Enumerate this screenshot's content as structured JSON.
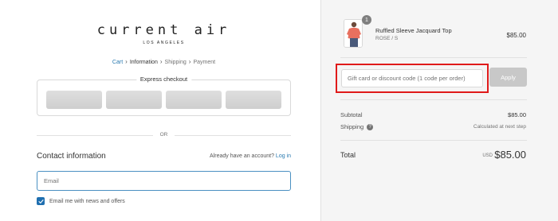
{
  "brand": {
    "name": "current air",
    "tagline": "LOS ANGELES"
  },
  "breadcrumb": {
    "items": [
      "Cart",
      "Information",
      "Shipping",
      "Payment"
    ],
    "current": "Information"
  },
  "express": {
    "title": "Express checkout"
  },
  "divider": {
    "label": "OR"
  },
  "contact": {
    "title": "Contact information",
    "account_prompt": "Already have an account?",
    "login_label": "Log in",
    "email_placeholder": "Email",
    "newsletter_label": "Email me with news and offers",
    "newsletter_checked": true
  },
  "order": {
    "item": {
      "name": "Ruffled Sleeve Jacquard Top",
      "variant": "ROSE / S",
      "price": "$85.00",
      "quantity": "1"
    },
    "discount": {
      "placeholder": "Gift card or discount code (1 code per order)",
      "apply_label": "Apply"
    },
    "subtotal_label": "Subtotal",
    "subtotal_value": "$85.00",
    "shipping_label": "Shipping",
    "shipping_value": "Calculated at next step",
    "total_label": "Total",
    "total_currency": "USD",
    "total_value": "$85.00"
  },
  "colors": {
    "link": "#2a7ab0",
    "highlight_border": "#e01a1a",
    "checkbox": "#1f6fb0"
  }
}
